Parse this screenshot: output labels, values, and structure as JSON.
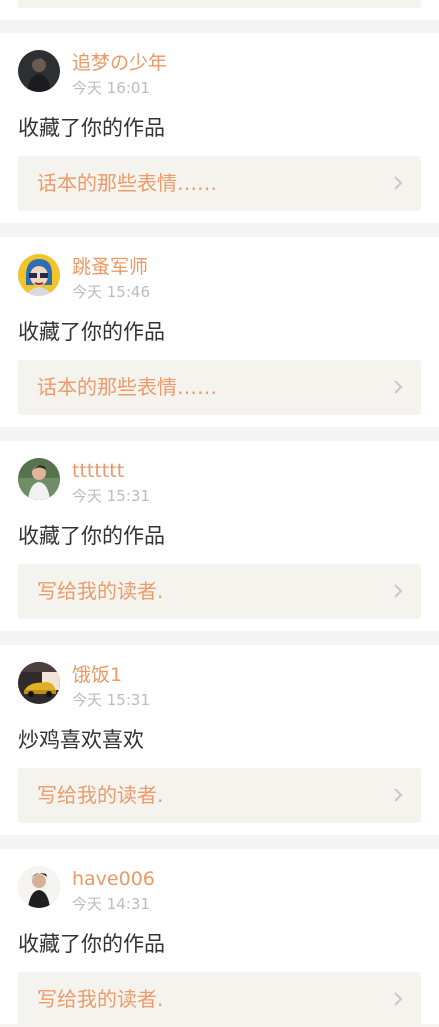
{
  "notifications": [
    {
      "username": "追梦の少年",
      "time": "今天 16:01",
      "message": "收藏了你的作品",
      "work_title": "话本的那些表情……",
      "avatar_icon": "avatar-dark-portrait-icon"
    },
    {
      "username": "跳蚤军师",
      "time": "今天 15:46",
      "message": "收藏了你的作品",
      "work_title": "话本的那些表情……",
      "avatar_icon": "avatar-cartoon-girl-icon"
    },
    {
      "username": "ttttttt",
      "time": "今天 15:31",
      "message": "收藏了你的作品",
      "work_title": "写给我的读者.",
      "avatar_icon": "avatar-outdoor-man-icon"
    },
    {
      "username": "饿饭1",
      "time": "今天 15:31",
      "message": "炒鸡喜欢喜欢",
      "work_title": "写给我的读者.",
      "avatar_icon": "avatar-yellow-car-icon"
    },
    {
      "username": "have006",
      "time": "今天 14:31",
      "message": "收藏了你的作品",
      "work_title": "写给我的读者.",
      "avatar_icon": "avatar-man-portrait-icon"
    }
  ],
  "colors": {
    "background": "#f5f4f2",
    "card": "#ffffff",
    "username": "#e89a66",
    "timestamp": "#bcbcbc",
    "message": "#333333",
    "work_link_bg": "#f4f3ee",
    "work_title": "#ed9b6a",
    "chevron": "#c8c8c8"
  }
}
